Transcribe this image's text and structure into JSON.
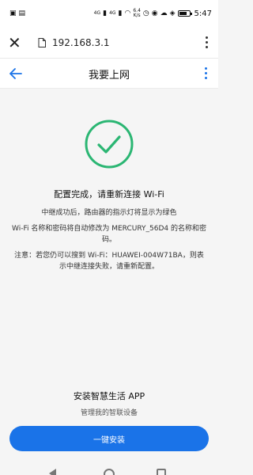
{
  "status_bar": {
    "time": "5:47",
    "network_rate_top": "6.4",
    "network_rate_unit": "K/s",
    "sim1": "4G",
    "sim2": "4G"
  },
  "browser": {
    "url": "192.168.3.1"
  },
  "header": {
    "title": "我要上网"
  },
  "main": {
    "headline": "配置完成，请重新连接 Wi-Fi",
    "line1": "中继成功后，路由器的指示灯将显示为绿色",
    "line2": "Wi-Fi 名称和密码将自动修改为 MERCURY_56D4 的名称和密码。",
    "line3": "注意：若您仍可以搜到 Wi-Fi：HUAWEI-004W71BA，则表示中继连接失败，请重新配置。"
  },
  "install": {
    "title": "安装智慧生活 APP",
    "subtitle": "管理我的智联设备",
    "button_label": "一键安装"
  },
  "colors": {
    "accent": "#1a73e8",
    "success": "#2bb673"
  }
}
